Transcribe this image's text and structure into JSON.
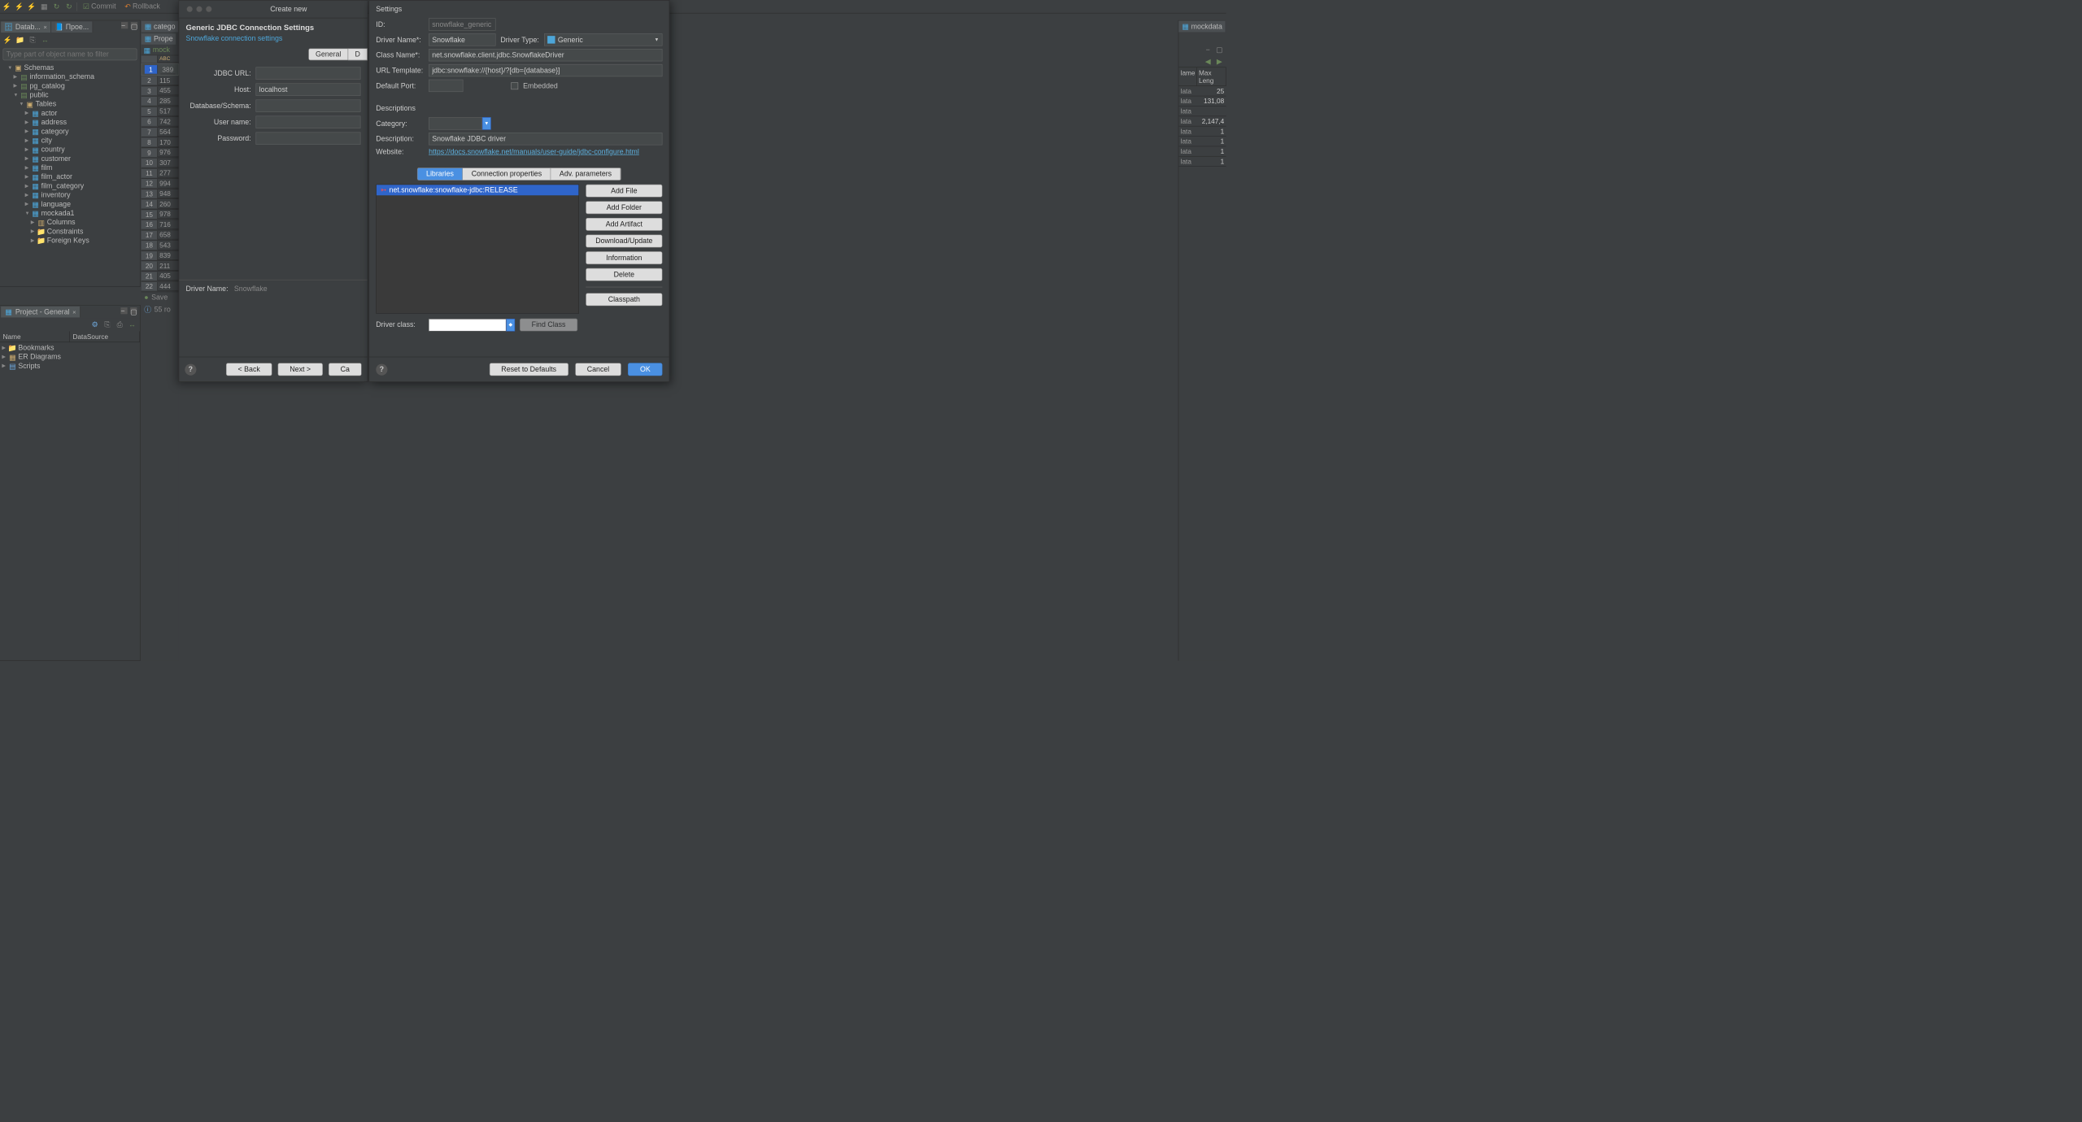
{
  "toolbar": {
    "commit": "Commit",
    "rollback": "Rollback"
  },
  "left": {
    "tabs": [
      "Datab...",
      "Прое..."
    ],
    "filter_ph": "Type part of object name to filter",
    "tree": {
      "schemas": "Schemas",
      "info": "information_schema",
      "pgc": "pg_catalog",
      "public": "public",
      "tables": "Tables",
      "items": [
        "actor",
        "address",
        "category",
        "city",
        "country",
        "customer",
        "film",
        "film_actor",
        "film_category",
        "inventory",
        "language",
        "mockada1"
      ],
      "cols": "Columns",
      "cons": "Constraints",
      "fk": "Foreign Keys"
    },
    "proj_title": "Project - General",
    "proj_cols": [
      "Name",
      "DataSource"
    ],
    "proj_items": [
      "Bookmarks",
      "ER Diagrams",
      "Scripts"
    ]
  },
  "mid": {
    "tabs": [
      "catego",
      "Prope"
    ],
    "obj": "mock",
    "rows": [
      "389",
      "115",
      "455",
      "285",
      "517",
      "742",
      "564",
      "170",
      "976",
      "307",
      "277",
      "994",
      "948",
      "260",
      "978",
      "716",
      "658",
      "543",
      "839",
      "211",
      "405",
      "444"
    ],
    "save": "Save",
    "rowcount": "55 ro"
  },
  "right": {
    "tab": "mockdata",
    "cols": [
      "lame",
      "Max Leng"
    ],
    "vals": [
      [
        "lata",
        "25"
      ],
      [
        "lata",
        "131,08"
      ],
      [
        "lata",
        ""
      ],
      [
        "lata",
        "2,147,4"
      ],
      [
        "lata",
        "1"
      ],
      [
        "lata",
        "1"
      ],
      [
        "lata",
        "1"
      ],
      [
        "lata",
        "1"
      ]
    ]
  },
  "dlg1": {
    "wintitle": "Create new",
    "title": "Generic JDBC Connection Settings",
    "sub": "Snowflake connection settings",
    "tabs": [
      "General",
      "D"
    ],
    "labels": {
      "url": "JDBC URL:",
      "host": "Host:",
      "db": "Database/Schema:",
      "user": "User name:",
      "pwd": "Password:"
    },
    "host_val": "localhost",
    "driver_lbl": "Driver Name:",
    "driver_val": "Snowflake",
    "back": "< Back",
    "next": "Next >",
    "cancel": "Ca"
  },
  "dlg2": {
    "sect1": "Settings",
    "id_lbl": "ID:",
    "id_val": "snowflake_generic",
    "dn_lbl": "Driver Name*:",
    "dn_val": "Snowflake",
    "dt_lbl": "Driver Type:",
    "dt_val": "Generic",
    "cn_lbl": "Class Name*:",
    "cn_val": "net.snowflake.client.jdbc.SnowflakeDriver",
    "ut_lbl": "URL Template:",
    "ut_val": "jdbc:snowflake://{host}/?[db={database}]",
    "dp_lbl": "Default Port:",
    "emb": "Embedded",
    "sect2": "Descriptions",
    "cat_lbl": "Category:",
    "desc_lbl": "Description:",
    "desc_val": "Snowflake JDBC driver",
    "web_lbl": "Website:",
    "web_val": "https://docs.snowflake.net/manuals/user-guide/jdbc-configure.html",
    "tabs": [
      "Libraries",
      "Connection properties",
      "Adv. parameters"
    ],
    "lib": "net.snowflake:snowflake-jdbc:RELEASE",
    "btns": {
      "addfile": "Add File",
      "addfolder": "Add Folder",
      "addart": "Add Artifact",
      "dl": "Download/Update",
      "info": "Information",
      "del": "Delete",
      "cp": "Classpath"
    },
    "dc_lbl": "Driver class:",
    "find": "Find Class",
    "reset": "Reset to Defaults",
    "cancel": "Cancel",
    "ok": "OK"
  }
}
